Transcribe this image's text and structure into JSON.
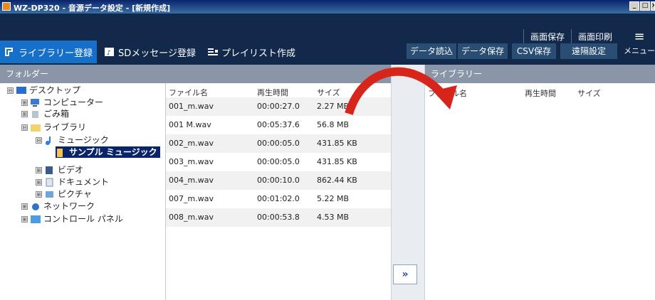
{
  "window": {
    "title": "WZ-DP320 - 音源データ設定 - [新規作成]",
    "controls": [
      "_",
      "□",
      "×"
    ]
  },
  "header": {
    "tabs": [
      {
        "label": "ライブラリー登録",
        "icon": "library-icon"
      },
      {
        "label": "SDメッセージ登録",
        "icon": "sd-message-icon"
      },
      {
        "label": "プレイリスト作成",
        "icon": "playlist-icon"
      }
    ],
    "top_buttons": [
      "画面保存",
      "画面印刷"
    ],
    "buttons": [
      "データ読込",
      "データ保存",
      "CSV保存",
      "遠隔設定"
    ],
    "menu_label": "メニュー"
  },
  "folder_panel": {
    "title": "フォルダー",
    "tree": [
      {
        "label": "デスクトップ",
        "toggle": "⊟",
        "icon": "desktop-icon"
      },
      {
        "label": "コンピューター",
        "toggle": "⊞",
        "icon": "computer-icon"
      },
      {
        "label": "ごみ箱",
        "toggle": "⊞",
        "icon": "recycle-bin-icon"
      },
      {
        "label": "ライブラリ",
        "toggle": "⊟",
        "icon": "library-folder-icon"
      },
      {
        "label": "ミュージック",
        "toggle": "⊟",
        "icon": "music-icon"
      },
      {
        "label": "サンプル ミュージック",
        "toggle": "",
        "icon": "folder-icon"
      },
      {
        "label": "ビデオ",
        "toggle": "⊞",
        "icon": "video-icon"
      },
      {
        "label": "ドキュメント",
        "toggle": "⊞",
        "icon": "documents-icon"
      },
      {
        "label": "ピクチャ",
        "toggle": "⊞",
        "icon": "pictures-icon"
      },
      {
        "label": "ネットワーク",
        "toggle": "⊞",
        "icon": "network-icon"
      },
      {
        "label": "コントロール パネル",
        "toggle": "⊞",
        "icon": "control-panel-icon"
      }
    ]
  },
  "file_list": {
    "columns": [
      "ファイル名",
      "再生時間",
      "サイズ"
    ],
    "rows": [
      [
        "001_m.wav",
        "00:00:27.0",
        "2.27 MB"
      ],
      [
        "001 M.wav",
        "00:05:37.6",
        "56.8 MB"
      ],
      [
        "002_m.wav",
        "00:00:05.0",
        "431.85 KB"
      ],
      [
        "003_m.wav",
        "00:00:05.0",
        "431.85 KB"
      ],
      [
        "004_m.wav",
        "00:00:10.0",
        "862.44 KB"
      ],
      [
        "007_m.wav",
        "00:01:02.0",
        "5.22 MB"
      ],
      [
        "008_m.wav",
        "00:00:53.8",
        "4.53 MB"
      ]
    ]
  },
  "move_button": {
    "label": "»"
  },
  "library_panel": {
    "title": "ライブラリー",
    "columns": [
      "ファイル名",
      "再生時間",
      "サイズ"
    ]
  },
  "colors": {
    "header_bg": "#13294b",
    "active_tab": "#1670c9",
    "panel_head": "#8a95a8",
    "arrow": "#d8251c"
  }
}
